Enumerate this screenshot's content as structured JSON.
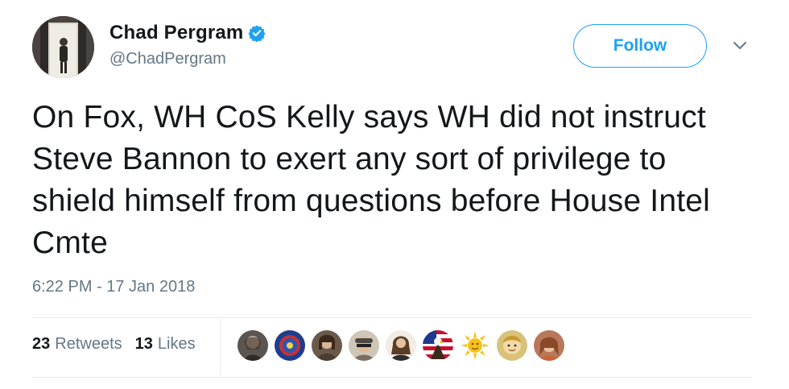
{
  "author": {
    "display_name": "Chad Pergram",
    "handle": "@ChadPergram",
    "verified_icon": "verified-badge-icon",
    "verified_color": "#1da1f2"
  },
  "follow_button": {
    "label": "Follow"
  },
  "menu": {
    "icon": "chevron-down-icon"
  },
  "tweet": {
    "text": "On Fox, WH CoS Kelly says WH did not instruct Steve Bannon to exert any sort of privilege to shield himself from questions before House Intel Cmte",
    "timestamp": "6:22 PM - 17 Jan 2018"
  },
  "stats": {
    "retweets": {
      "count": "23",
      "label": "Retweets"
    },
    "likes": {
      "count": "13",
      "label": "Likes"
    }
  },
  "liked_by_avatars": 9,
  "colors": {
    "accent": "#1da1f2",
    "text": "#14171a",
    "muted": "#657786",
    "border": "#e6ecf0"
  }
}
